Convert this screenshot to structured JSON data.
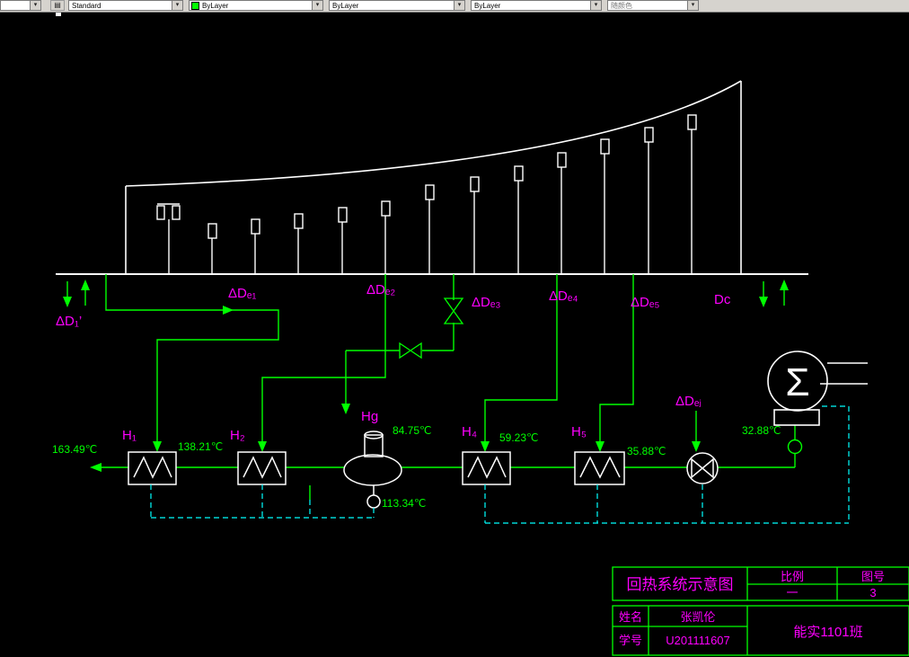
{
  "toolbar": {
    "combo0": "",
    "style": "Standard",
    "color": "ByLayer",
    "linetype": "ByLayer",
    "lineweight": "ByLayer",
    "plotstyle": "随颜色",
    "swatch_color": "#00ff00",
    "icon_glyph": "▤",
    "arrow_glyph": "▾"
  },
  "diagram": {
    "labels": {
      "dd1p": "ΔD₁’",
      "de1": "ΔDₑ₁",
      "de2": "ΔDₑ₂",
      "de3": "ΔDₑ₃",
      "de4": "ΔDₑ₄",
      "de5": "ΔDₑ₅",
      "dc": "Dc",
      "dej": "ΔDₑⱼ",
      "h1": "H₁",
      "h2": "H₂",
      "hg": "Hg",
      "h4": "H₄",
      "h5": "H₅"
    },
    "temps": {
      "t163": "163.49℃",
      "t138": "138.21℃",
      "t84": "84.75℃",
      "t59": "59.23℃",
      "t113": "113.34℃",
      "t35": "35.88℃",
      "t32": "32.88℃"
    },
    "sigma": "Σ"
  },
  "titleblock": {
    "title": "回热系统示意图",
    "scale_label": "比例",
    "scale_value": "一",
    "figno_label": "图号",
    "figno_value": "3",
    "name_label": "姓名",
    "name_value": "张凯伦",
    "id_label": "学号",
    "id_value": "U201111607",
    "class_value": "能实1101班"
  },
  "colors": {
    "line_green": "#00ff00",
    "label_magenta": "#ff00ff",
    "drain_cyan": "#00ffff",
    "outline_white": "#ffffff"
  }
}
